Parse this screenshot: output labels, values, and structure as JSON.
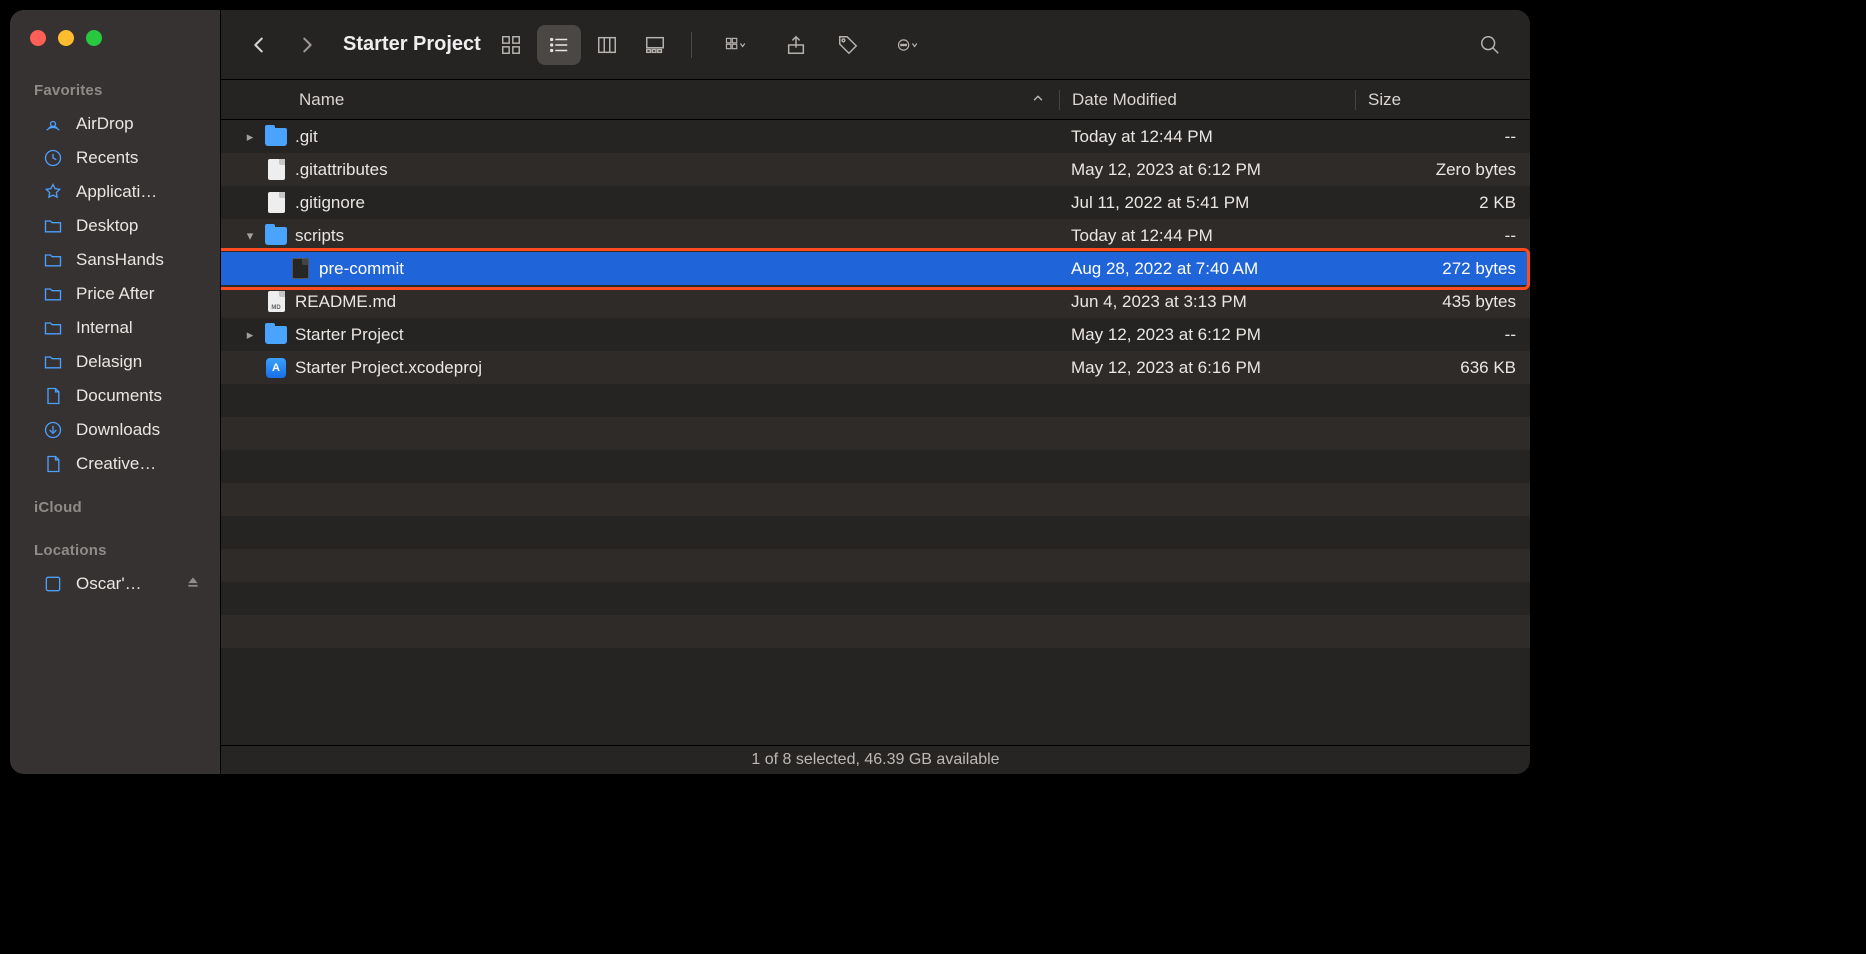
{
  "window": {
    "title": "Starter Project"
  },
  "sidebar": {
    "sections": [
      {
        "header": "Favorites",
        "items": [
          {
            "label": "AirDrop",
            "icon": "airdrop"
          },
          {
            "label": "Recents",
            "icon": "clock"
          },
          {
            "label": "Applicati…",
            "icon": "apps"
          },
          {
            "label": "Desktop",
            "icon": "folder"
          },
          {
            "label": "SansHands",
            "icon": "folder"
          },
          {
            "label": "Price After",
            "icon": "folder"
          },
          {
            "label": "Internal",
            "icon": "folder"
          },
          {
            "label": "Delasign",
            "icon": "folder"
          },
          {
            "label": "Documents",
            "icon": "doc"
          },
          {
            "label": "Downloads",
            "icon": "download"
          },
          {
            "label": "Creative…",
            "icon": "doc"
          }
        ]
      },
      {
        "header": "iCloud",
        "items": []
      },
      {
        "header": "Locations",
        "items": [
          {
            "label": "Oscar'…",
            "icon": "drive",
            "ejectable": true
          }
        ]
      }
    ]
  },
  "columns": {
    "name": "Name",
    "date": "Date Modified",
    "size": "Size"
  },
  "rows": [
    {
      "indent": 0,
      "name": ".git",
      "icon": "folder",
      "date": "Today at 12:44 PM",
      "size": "--",
      "disclosure": "closed"
    },
    {
      "indent": 0,
      "name": ".gitattributes",
      "icon": "doc",
      "date": "May 12, 2023 at 6:12 PM",
      "size": "Zero bytes"
    },
    {
      "indent": 0,
      "name": ".gitignore",
      "icon": "doc",
      "date": "Jul 11, 2022 at 5:41 PM",
      "size": "2 KB"
    },
    {
      "indent": 0,
      "name": "scripts",
      "icon": "folder",
      "date": "Today at 12:44 PM",
      "size": "--",
      "disclosure": "open"
    },
    {
      "indent": 1,
      "name": "pre-commit",
      "icon": "exec",
      "date": "Aug 28, 2022 at 7:40 AM",
      "size": "272 bytes",
      "selected": true,
      "highlighted": true
    },
    {
      "indent": 0,
      "name": "README.md",
      "icon": "md",
      "date": "Jun 4, 2023 at 3:13 PM",
      "size": "435 bytes"
    },
    {
      "indent": 0,
      "name": "Starter Project",
      "icon": "folder",
      "date": "May 12, 2023 at 6:12 PM",
      "size": "--",
      "disclosure": "closed"
    },
    {
      "indent": 0,
      "name": "Starter Project.xcodeproj",
      "icon": "xcode",
      "date": "May 12, 2023 at 6:16 PM",
      "size": "636 KB"
    }
  ],
  "blank_rows": 9,
  "status": "1 of 8 selected, 46.39 GB available"
}
